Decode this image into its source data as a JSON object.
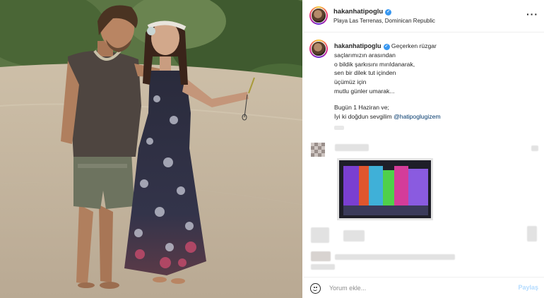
{
  "post": {
    "username": "hakanhatipoglu",
    "location": "Playa Las Terrenas, Dominican Republic",
    "more_icon": "more-options-icon",
    "verified_icon": "verified-badge-icon"
  },
  "caption": {
    "lines": [
      "Geçerken rüzgar",
      "saçlarımızın arasından",
      "o bildik şarkısını mırıldanarak,",
      "sen bir dilek tut içinden",
      "üçümüz için",
      "mutlu günler umarak...",
      "",
      "Bugün 1 Haziran ve;",
      "İyi ki doğdun sevgilim"
    ],
    "mention": "@hatipoglugizem"
  },
  "footer": {
    "comment_placeholder": "Yorum ekle...",
    "post_label": "Paylaş",
    "emoji_icon": "emoji-icon"
  },
  "colors": {
    "verified": "#3897f0",
    "mention": "#00376b",
    "post_button_disabled": "#b3dbff"
  }
}
